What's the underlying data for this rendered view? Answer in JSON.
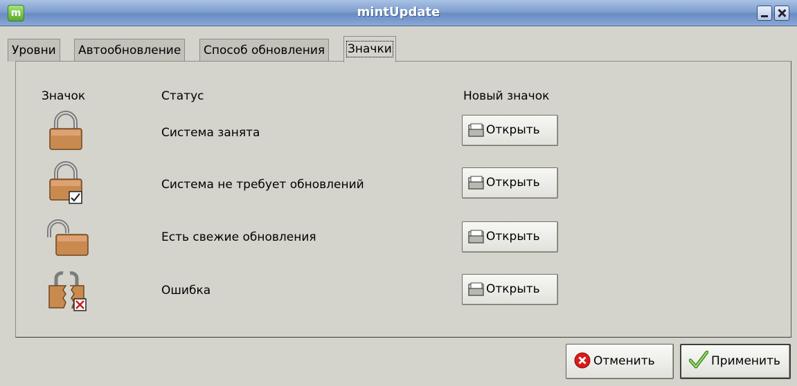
{
  "window": {
    "title": "mintUpdate",
    "app_icon": "mint-logo-icon",
    "app_icon_letter": "m",
    "controls": [
      "minimize-icon",
      "close-icon"
    ]
  },
  "tabs": [
    {
      "label": "Уровни",
      "active": false
    },
    {
      "label": "Автообновление",
      "active": false
    },
    {
      "label": "Способ обновления",
      "active": false
    },
    {
      "label": "Значки",
      "active": true
    }
  ],
  "icons_page": {
    "headers": {
      "icon": "Значок",
      "status": "Статус",
      "new_icon": "Новый значок"
    },
    "rows": [
      {
        "status": "Система занята",
        "icon": "lock-closed-icon",
        "button_label": "Открыть",
        "button_icon": "folder-icon"
      },
      {
        "status": "Система не требует обновлений",
        "icon": "lock-closed-check-icon",
        "button_label": "Открыть",
        "button_icon": "folder-icon"
      },
      {
        "status": "Есть свежие обновления",
        "icon": "lock-open-icon",
        "button_label": "Открыть",
        "button_icon": "folder-icon"
      },
      {
        "status": "Ошибка",
        "icon": "lock-broken-error-icon",
        "button_label": "Открыть",
        "button_icon": "folder-icon"
      }
    ]
  },
  "buttons": {
    "cancel": {
      "label": "Отменить",
      "icon": "cancel-icon"
    },
    "apply": {
      "label": "Применить",
      "icon": "checkmark-icon"
    }
  },
  "colors": {
    "titlebar": "#7f9fcf",
    "window_bg": "#d4d4cc",
    "lock_body": "#c98a50",
    "error_red": "#d81b1b"
  }
}
